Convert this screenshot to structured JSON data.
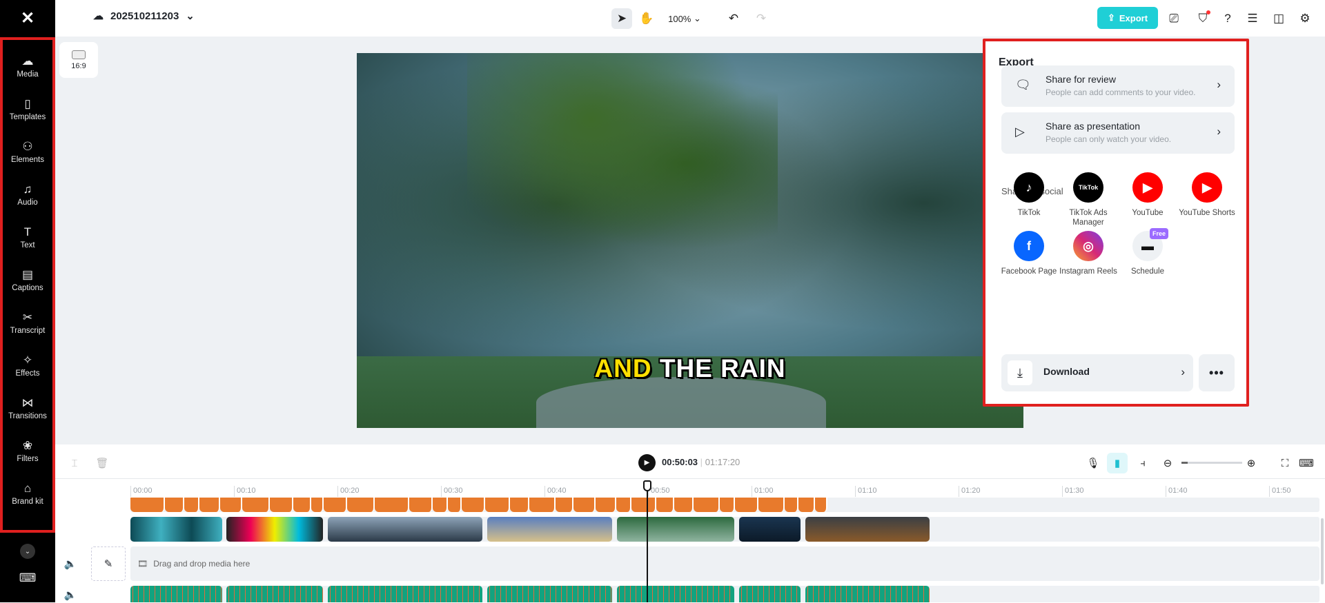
{
  "app": {
    "logo": "capcut-logo",
    "project_title": "202510211203",
    "zoom_level": "100%",
    "export_label": "Export"
  },
  "sidebar": {
    "items": [
      {
        "label": "Media",
        "icon": "☁"
      },
      {
        "label": "Templates",
        "icon": "▯"
      },
      {
        "label": "Elements",
        "icon": "⚇"
      },
      {
        "label": "Audio",
        "icon": "♫"
      },
      {
        "label": "Text",
        "icon": "T"
      },
      {
        "label": "Captions",
        "icon": "▤"
      },
      {
        "label": "Transcript",
        "icon": "✂"
      },
      {
        "label": "Effects",
        "icon": "✧"
      },
      {
        "label": "Transitions",
        "icon": "⋈"
      },
      {
        "label": "Filters",
        "icon": "❀"
      },
      {
        "label": "Brand kit",
        "icon": "⌂"
      }
    ]
  },
  "canvas": {
    "aspect_ratio": "16:9",
    "caption_highlight": "AND",
    "caption_rest": "THE RAIN"
  },
  "export_panel": {
    "title": "Export",
    "share_review": {
      "title": "Share for review",
      "desc": "People can add comments to your video."
    },
    "share_presentation": {
      "title": "Share as presentation",
      "desc": "People can only watch your video."
    },
    "social_label": "Share on social",
    "social": [
      {
        "label": "TikTok",
        "color": "#000000",
        "glyph": "♪"
      },
      {
        "label": "TikTok Ads Manager",
        "color": "#000000",
        "glyph": "TikTok"
      },
      {
        "label": "YouTube",
        "color": "#ff0000",
        "glyph": "▶"
      },
      {
        "label": "YouTube Shorts",
        "color": "#ff0000",
        "glyph": "▶"
      },
      {
        "label": "Facebook Page",
        "color": "#0866ff",
        "glyph": "f"
      },
      {
        "label": "Instagram Reels",
        "color": "#d62976",
        "glyph": "◎"
      },
      {
        "label": "Schedule",
        "color": "#eef1f4",
        "glyph": "▬",
        "badge": "Free"
      }
    ],
    "download_label": "Download",
    "more_label": "•••"
  },
  "timeline": {
    "current_time": "00:50:03",
    "total_time": "01:17:20",
    "ticks": [
      "00:00",
      "00:10",
      "00:20",
      "00:30",
      "00:40",
      "00:50",
      "01:00",
      "01:10",
      "01:20",
      "01:30",
      "01:40",
      "01:50"
    ],
    "drop_hint": "Drag and drop media here",
    "zoom_fraction": 0.1
  },
  "colors": {
    "accent": "#1fcfd6",
    "caption_track": "#e87a2c",
    "audio_track": "#12a37f",
    "highlight": "#e0201f"
  }
}
